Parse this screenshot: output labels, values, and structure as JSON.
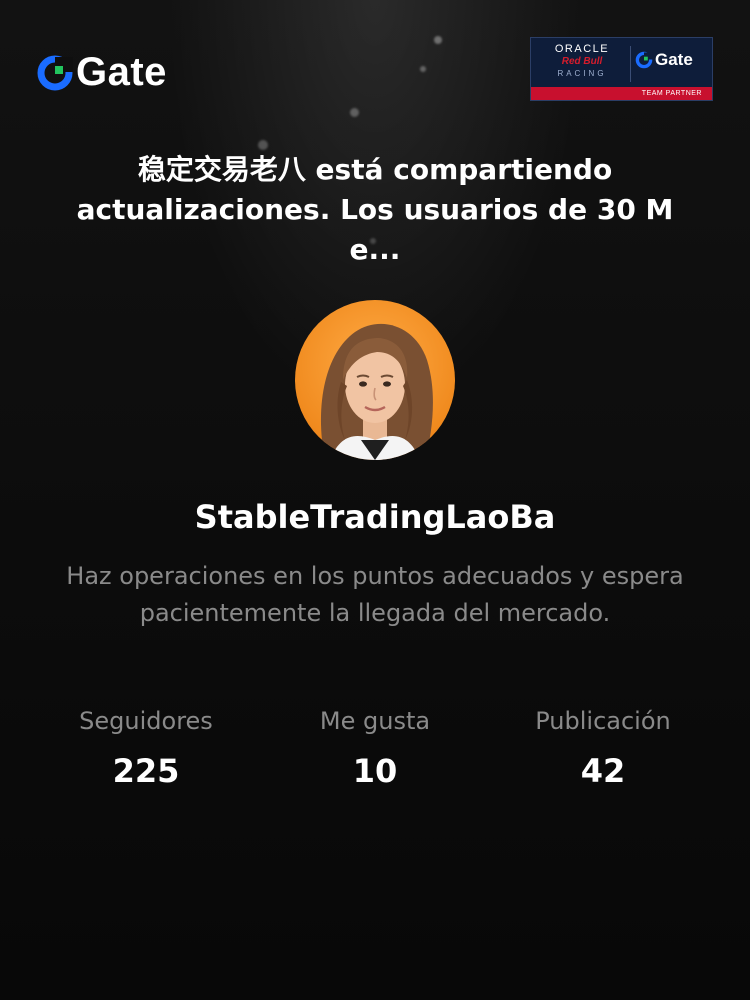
{
  "brand": {
    "name": "Gate",
    "logo_icon": "gate-logo-icon",
    "accent": "#1a6cff",
    "accent_secondary": "#22c55e"
  },
  "partner": {
    "line1": "ORACLE",
    "line2": "Red Bull",
    "line3": "RACING",
    "brand": "Gate",
    "footer": "TEAM PARTNER",
    "bg_color": "#0e1d3a",
    "stripe_color": "#c8102e"
  },
  "headline": "稳定交易老八 está compartiendo actualizaciones. Los usuarios de 30 M e...",
  "profile": {
    "avatar_icon": "avatar-woman-portrait",
    "username": "StableTradingLaoBa",
    "bio": "Haz operaciones en los puntos adecuados y espera pacientemente la llegada del mercado."
  },
  "stats": [
    {
      "label": "Seguidores",
      "value": "225"
    },
    {
      "label": "Me gusta",
      "value": "10"
    },
    {
      "label": "Publicación",
      "value": "42"
    }
  ]
}
